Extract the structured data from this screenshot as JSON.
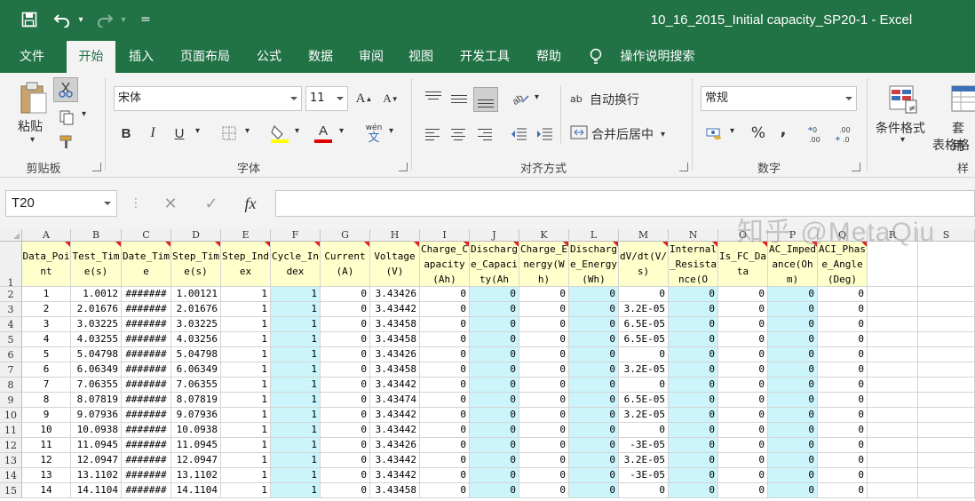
{
  "window": {
    "title": "10_16_2015_Initial capacity_SP20-1  -  Excel",
    "qat_customize": "="
  },
  "tabs": [
    {
      "label": "文件"
    },
    {
      "label": "开始"
    },
    {
      "label": "插入"
    },
    {
      "label": "页面布局"
    },
    {
      "label": "公式"
    },
    {
      "label": "数据"
    },
    {
      "label": "审阅"
    },
    {
      "label": "视图"
    },
    {
      "label": "开发工具"
    },
    {
      "label": "帮助"
    }
  ],
  "active_tab": "开始",
  "tell_me": "操作说明搜索",
  "ribbon": {
    "clipboard": {
      "paste_label": "粘贴",
      "group_label": "剪贴板"
    },
    "font": {
      "font_name": "宋体",
      "font_size": "11",
      "grow": "A",
      "shrink": "A",
      "bold": "B",
      "italic": "I",
      "underline": "U",
      "font_color_letter": "A",
      "wen_label": "wén",
      "wen_char": "文",
      "group_label": "字体"
    },
    "alignment": {
      "wrap_text": "自动换行",
      "merge_center": "合并后居中",
      "wrap_icon": "ab",
      "group_label": "对齐方式"
    },
    "number": {
      "format": "常规",
      "percent": "%",
      "comma": ",",
      "group_label": "数字"
    },
    "styles": {
      "conditional_formatting": "条件格式",
      "format_as_table_line1": "套用",
      "format_as_table_line2": "表格格",
      "group_label_partial": "样"
    }
  },
  "formula_bar": {
    "name_box": "T20",
    "fx": "fx",
    "formula": ""
  },
  "sheet": {
    "column_letters": [
      "A",
      "B",
      "C",
      "D",
      "E",
      "F",
      "G",
      "H",
      "I",
      "J",
      "K",
      "L",
      "M",
      "N",
      "O",
      "P",
      "Q",
      "R",
      "S"
    ],
    "headers": [
      "Data_Point",
      "Test_Time(s)",
      "Date_Time",
      "Step_Time(s)",
      "Step_Index",
      "Cycle_Index",
      "Current(A)",
      "Voltage(V)",
      "Charge_Capacity(Ah)",
      "Discharge_Capacity(Ah",
      "Charge_Energy(Wh)",
      "Discharge_Energy(Wh)",
      "dV/dt(V/s)",
      "Internal_Resistance(O",
      "Is_FC_Data",
      "AC_Impedance(Ohm)",
      "ACI_Phase_Angle(Deg)"
    ],
    "header_row_number": "1",
    "rows": [
      {
        "rn": "2",
        "c": [
          "1",
          "1.0012",
          "#######",
          "1.00121",
          "1",
          "1",
          "0",
          "3.43426",
          "0",
          "0",
          "0",
          "0",
          "0",
          "0",
          "0",
          "0",
          "0"
        ]
      },
      {
        "rn": "3",
        "c": [
          "2",
          "2.01676",
          "#######",
          "2.01676",
          "1",
          "1",
          "0",
          "3.43442",
          "0",
          "0",
          "0",
          "0",
          "3.2E-05",
          "0",
          "0",
          "0",
          "0"
        ]
      },
      {
        "rn": "4",
        "c": [
          "3",
          "3.03225",
          "#######",
          "3.03225",
          "1",
          "1",
          "0",
          "3.43458",
          "0",
          "0",
          "0",
          "0",
          "6.5E-05",
          "0",
          "0",
          "0",
          "0"
        ]
      },
      {
        "rn": "5",
        "c": [
          "4",
          "4.03255",
          "#######",
          "4.03256",
          "1",
          "1",
          "0",
          "3.43458",
          "0",
          "0",
          "0",
          "0",
          "6.5E-05",
          "0",
          "0",
          "0",
          "0"
        ]
      },
      {
        "rn": "6",
        "c": [
          "5",
          "5.04798",
          "#######",
          "5.04798",
          "1",
          "1",
          "0",
          "3.43426",
          "0",
          "0",
          "0",
          "0",
          "0",
          "0",
          "0",
          "0",
          "0"
        ]
      },
      {
        "rn": "7",
        "c": [
          "6",
          "6.06349",
          "#######",
          "6.06349",
          "1",
          "1",
          "0",
          "3.43458",
          "0",
          "0",
          "0",
          "0",
          "3.2E-05",
          "0",
          "0",
          "0",
          "0"
        ]
      },
      {
        "rn": "8",
        "c": [
          "7",
          "7.06355",
          "#######",
          "7.06355",
          "1",
          "1",
          "0",
          "3.43442",
          "0",
          "0",
          "0",
          "0",
          "0",
          "0",
          "0",
          "0",
          "0"
        ]
      },
      {
        "rn": "9",
        "c": [
          "8",
          "8.07819",
          "#######",
          "8.07819",
          "1",
          "1",
          "0",
          "3.43474",
          "0",
          "0",
          "0",
          "0",
          "6.5E-05",
          "0",
          "0",
          "0",
          "0"
        ]
      },
      {
        "rn": "10",
        "c": [
          "9",
          "9.07936",
          "#######",
          "9.07936",
          "1",
          "1",
          "0",
          "3.43442",
          "0",
          "0",
          "0",
          "0",
          "3.2E-05",
          "0",
          "0",
          "0",
          "0"
        ]
      },
      {
        "rn": "11",
        "c": [
          "10",
          "10.0938",
          "#######",
          "10.0938",
          "1",
          "1",
          "0",
          "3.43442",
          "0",
          "0",
          "0",
          "0",
          "0",
          "0",
          "0",
          "0",
          "0"
        ]
      },
      {
        "rn": "12",
        "c": [
          "11",
          "11.0945",
          "#######",
          "11.0945",
          "1",
          "1",
          "0",
          "3.43426",
          "0",
          "0",
          "0",
          "0",
          "-3E-05",
          "0",
          "0",
          "0",
          "0"
        ]
      },
      {
        "rn": "13",
        "c": [
          "12",
          "12.0947",
          "#######",
          "12.0947",
          "1",
          "1",
          "0",
          "3.43442",
          "0",
          "0",
          "0",
          "0",
          "3.2E-05",
          "0",
          "0",
          "0",
          "0"
        ]
      },
      {
        "rn": "14",
        "c": [
          "13",
          "13.1102",
          "#######",
          "13.1102",
          "1",
          "1",
          "0",
          "3.43442",
          "0",
          "0",
          "0",
          "0",
          "-3E-05",
          "0",
          "0",
          "0",
          "0"
        ]
      },
      {
        "rn": "15",
        "c": [
          "14",
          "14.1104",
          "#######",
          "14.1104",
          "1",
          "1",
          "0",
          "3.43458",
          "0",
          "0",
          "0",
          "0",
          "0",
          "0",
          "0",
          "0",
          "0"
        ]
      }
    ]
  },
  "watermark": "知乎 @MetaQiu",
  "colors": {
    "excel_green": "#217346",
    "header_fill": "#ffffcc",
    "highlight_fill": "#ccf5fb",
    "comment_red": "#e02020"
  }
}
